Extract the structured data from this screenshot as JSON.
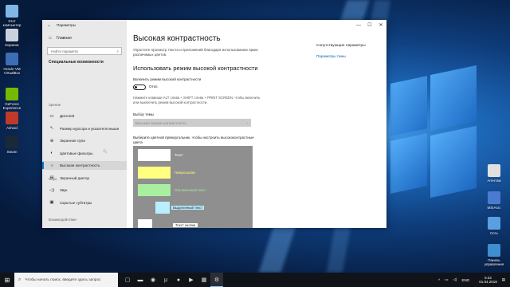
{
  "desktop": {
    "left_icons": [
      {
        "label": "Этот компьютер",
        "color": "#7fb6e6"
      },
      {
        "label": "Корзина",
        "color": "#c9d2dc"
      },
      {
        "label": "Oracle VM VirtualBox",
        "color": "#3d6db5"
      },
      {
        "label": "GeForce Experience",
        "color": "#76b900"
      },
      {
        "label": "Ashoid",
        "color": "#c0392b"
      },
      {
        "label": "Steam",
        "color": "#1b2838"
      }
    ],
    "right_icons": [
      {
        "label": "Агентам",
        "color": "#e0e0e0"
      },
      {
        "label": "MSIAsrc",
        "color": "#4b7bd0"
      },
      {
        "label": "Сеть",
        "color": "#5aa0e0"
      },
      {
        "label": "Панель управления",
        "color": "#3e8ed0"
      }
    ]
  },
  "window": {
    "app_title": "Параметры",
    "controls": {
      "minimize": "—",
      "maximize": "☐",
      "close": "✕"
    },
    "sidebar": {
      "home": "Главная",
      "search_placeholder": "Найти параметр",
      "section_title": "Специальные возможности",
      "group_vision": "Зрение",
      "items_vision": [
        {
          "label": "Дисплей",
          "icon": "display-icon",
          "glyph": "▭"
        },
        {
          "label": "Размер курсора и указателя мыши",
          "icon": "cursor-icon",
          "glyph": "↖"
        },
        {
          "label": "Экранная лупа",
          "icon": "magnifier-icon",
          "glyph": "⊕"
        },
        {
          "label": "Цветовые фильтры",
          "icon": "color-filter-icon",
          "glyph": "◐"
        },
        {
          "label": "Высокая контрастность",
          "icon": "contrast-icon",
          "glyph": "☼"
        },
        {
          "label": "Экранный диктор",
          "icon": "narrator-icon",
          "glyph": "▤"
        }
      ],
      "group_hearing": "Слух",
      "items_hearing": [
        {
          "label": "Звук",
          "icon": "sound-icon",
          "glyph": "◁)"
        },
        {
          "label": "Скрытые субтитры",
          "icon": "captions-icon",
          "glyph": "▣"
        }
      ],
      "group_interaction": "Взаимодействие"
    },
    "content": {
      "title": "Высокая контрастность",
      "description": "Упростите просмотр текста и приложений благодаря использованию ярких различимых цветов.",
      "section_title": "Использовать режим высокой контрастности",
      "toggle_label": "Включить режим высокой контрастности",
      "toggle_state": "Откл.",
      "hint": "Нажмите клавиши ALT слева + SHIFT слева + PRINT SCREEN, чтобы включить или выключить режим высокой контрастности.",
      "theme_label": "Выбор темы",
      "theme_value": "Высокая черная контрастность",
      "pick_label": "Выберите цветной прямоугольник, чтобы настроить высококонтрастные цвета",
      "swatches": [
        {
          "label": "Текст",
          "color": "#ffffff",
          "label_color": "#ffffff"
        },
        {
          "label": "Гиперссылки",
          "color": "#ffff80",
          "label_color": "#ffff80"
        },
        {
          "label": "Отключенный текст",
          "color": "#a8f0a0",
          "label_color": "#a8f0a0"
        },
        {
          "label": "Выделенный текст",
          "color": "#b8eeff",
          "label_color": "#1a1a1a"
        },
        {
          "label": "Текст кнопки",
          "color": "#ffffff",
          "label_color": "#ffffff"
        }
      ],
      "related_title": "Сопутствующие параметры",
      "related_link": "Параметры темы"
    }
  },
  "taskbar": {
    "start_glyph": "⊞",
    "search_placeholder": "Чтобы начать поиск, введите здесь запрос",
    "search_icon": "search-icon",
    "apps": [
      {
        "name": "taskview-icon",
        "glyph": "▢"
      },
      {
        "name": "explorer-icon",
        "glyph": "▬"
      },
      {
        "name": "chrome-icon",
        "glyph": "◉"
      },
      {
        "name": "utorrent-icon",
        "glyph": "µ"
      },
      {
        "name": "app-icon",
        "glyph": "●"
      },
      {
        "name": "media-icon",
        "glyph": "▶"
      },
      {
        "name": "store-icon",
        "glyph": "▦"
      },
      {
        "name": "settings-icon",
        "glyph": "⚙"
      }
    ],
    "tray": {
      "lang": "ENG",
      "time": "5:32",
      "date": "01.04.2019"
    }
  }
}
